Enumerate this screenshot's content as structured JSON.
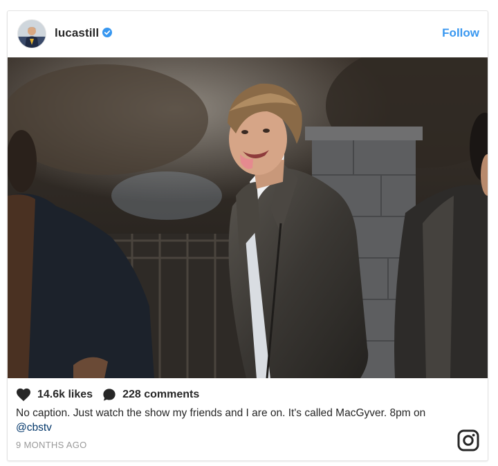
{
  "header": {
    "username": "lucastill",
    "follow_label": "Follow"
  },
  "stats": {
    "likes": "14.6k likes",
    "comments": "228 comments"
  },
  "caption": {
    "text": "No caption. Just watch the show my friends and I are on. It's called MacGyver. 8pm on ",
    "mention": "@cbstv"
  },
  "timestamp": "9 MONTHS AGO",
  "icons": {
    "verified": "verified-badge-icon",
    "likes": "heart-icon",
    "comments": "comment-bubble-icon",
    "brand": "instagram-icon"
  },
  "colors": {
    "accent": "#3897f0",
    "mention": "#003569",
    "text": "#262626",
    "muted": "#999999"
  }
}
